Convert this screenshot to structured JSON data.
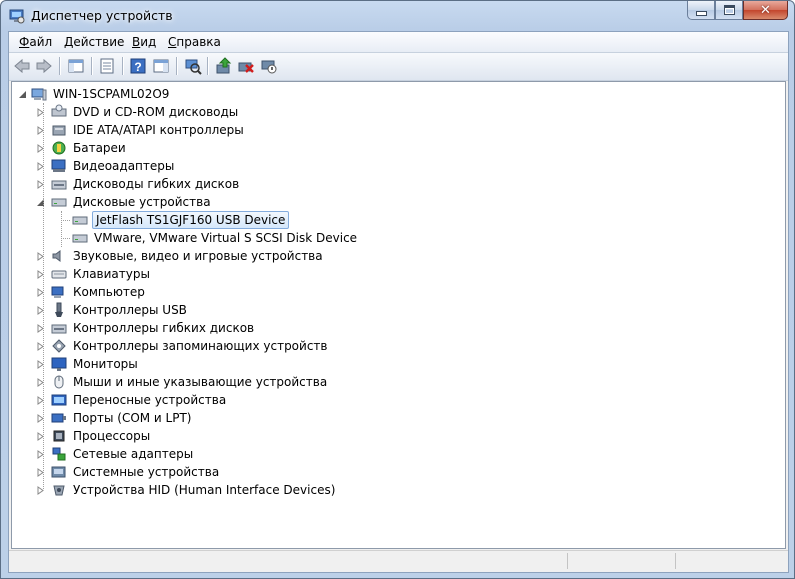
{
  "window": {
    "title": "Диспетчер устройств",
    "close_symbol": "✕"
  },
  "menu": [
    {
      "label": "Файл",
      "accel": "Ф",
      "rest": "айл"
    },
    {
      "label": "Действие",
      "accel": "Д",
      "rest": "ействие"
    },
    {
      "label": "Вид",
      "accel": "В",
      "rest": "ид"
    },
    {
      "label": "Справка",
      "accel": "С",
      "rest": "правка"
    }
  ],
  "toolbar": {
    "icons": [
      "back-arrow-icon",
      "forward-arrow-icon",
      "show-hide-console-tree-icon",
      "properties-icon",
      "help-icon",
      "show-hide-action-pane-icon",
      "scan-hardware-changes-icon",
      "update-driver-icon",
      "uninstall-icon",
      "disable-device-icon"
    ]
  },
  "tree": {
    "root": "WIN-1SCPAML02O9",
    "categories": [
      "DVD и CD-ROM дисководы",
      "IDE ATA/ATAPI контроллеры",
      "Батареи",
      "Видеоадаптеры",
      "Дисководы гибких дисков",
      "Дисковые устройства",
      "Звуковые, видео и игровые устройства",
      "Клавиатуры",
      "Компьютер",
      "Контроллеры USB",
      "Контроллеры гибких дисков",
      "Контроллеры запоминающих устройств",
      "Мониторы",
      "Мыши и иные указывающие устройства",
      "Переносные устройства",
      "Порты (COM и LPT)",
      "Процессоры",
      "Сетевые адаптеры",
      "Системные устройства",
      "Устройства HID (Human Interface Devices)"
    ],
    "disk_devices": [
      "JetFlash TS1GJF160 USB Device",
      "VMware, VMware Virtual S SCSI Disk Device"
    ],
    "selected": "JetFlash TS1GJF160 USB Device"
  },
  "colors": {
    "title_gradient_top": "#c8daf0",
    "selection_border": "#84acdd",
    "close_button": "#c3452d"
  }
}
